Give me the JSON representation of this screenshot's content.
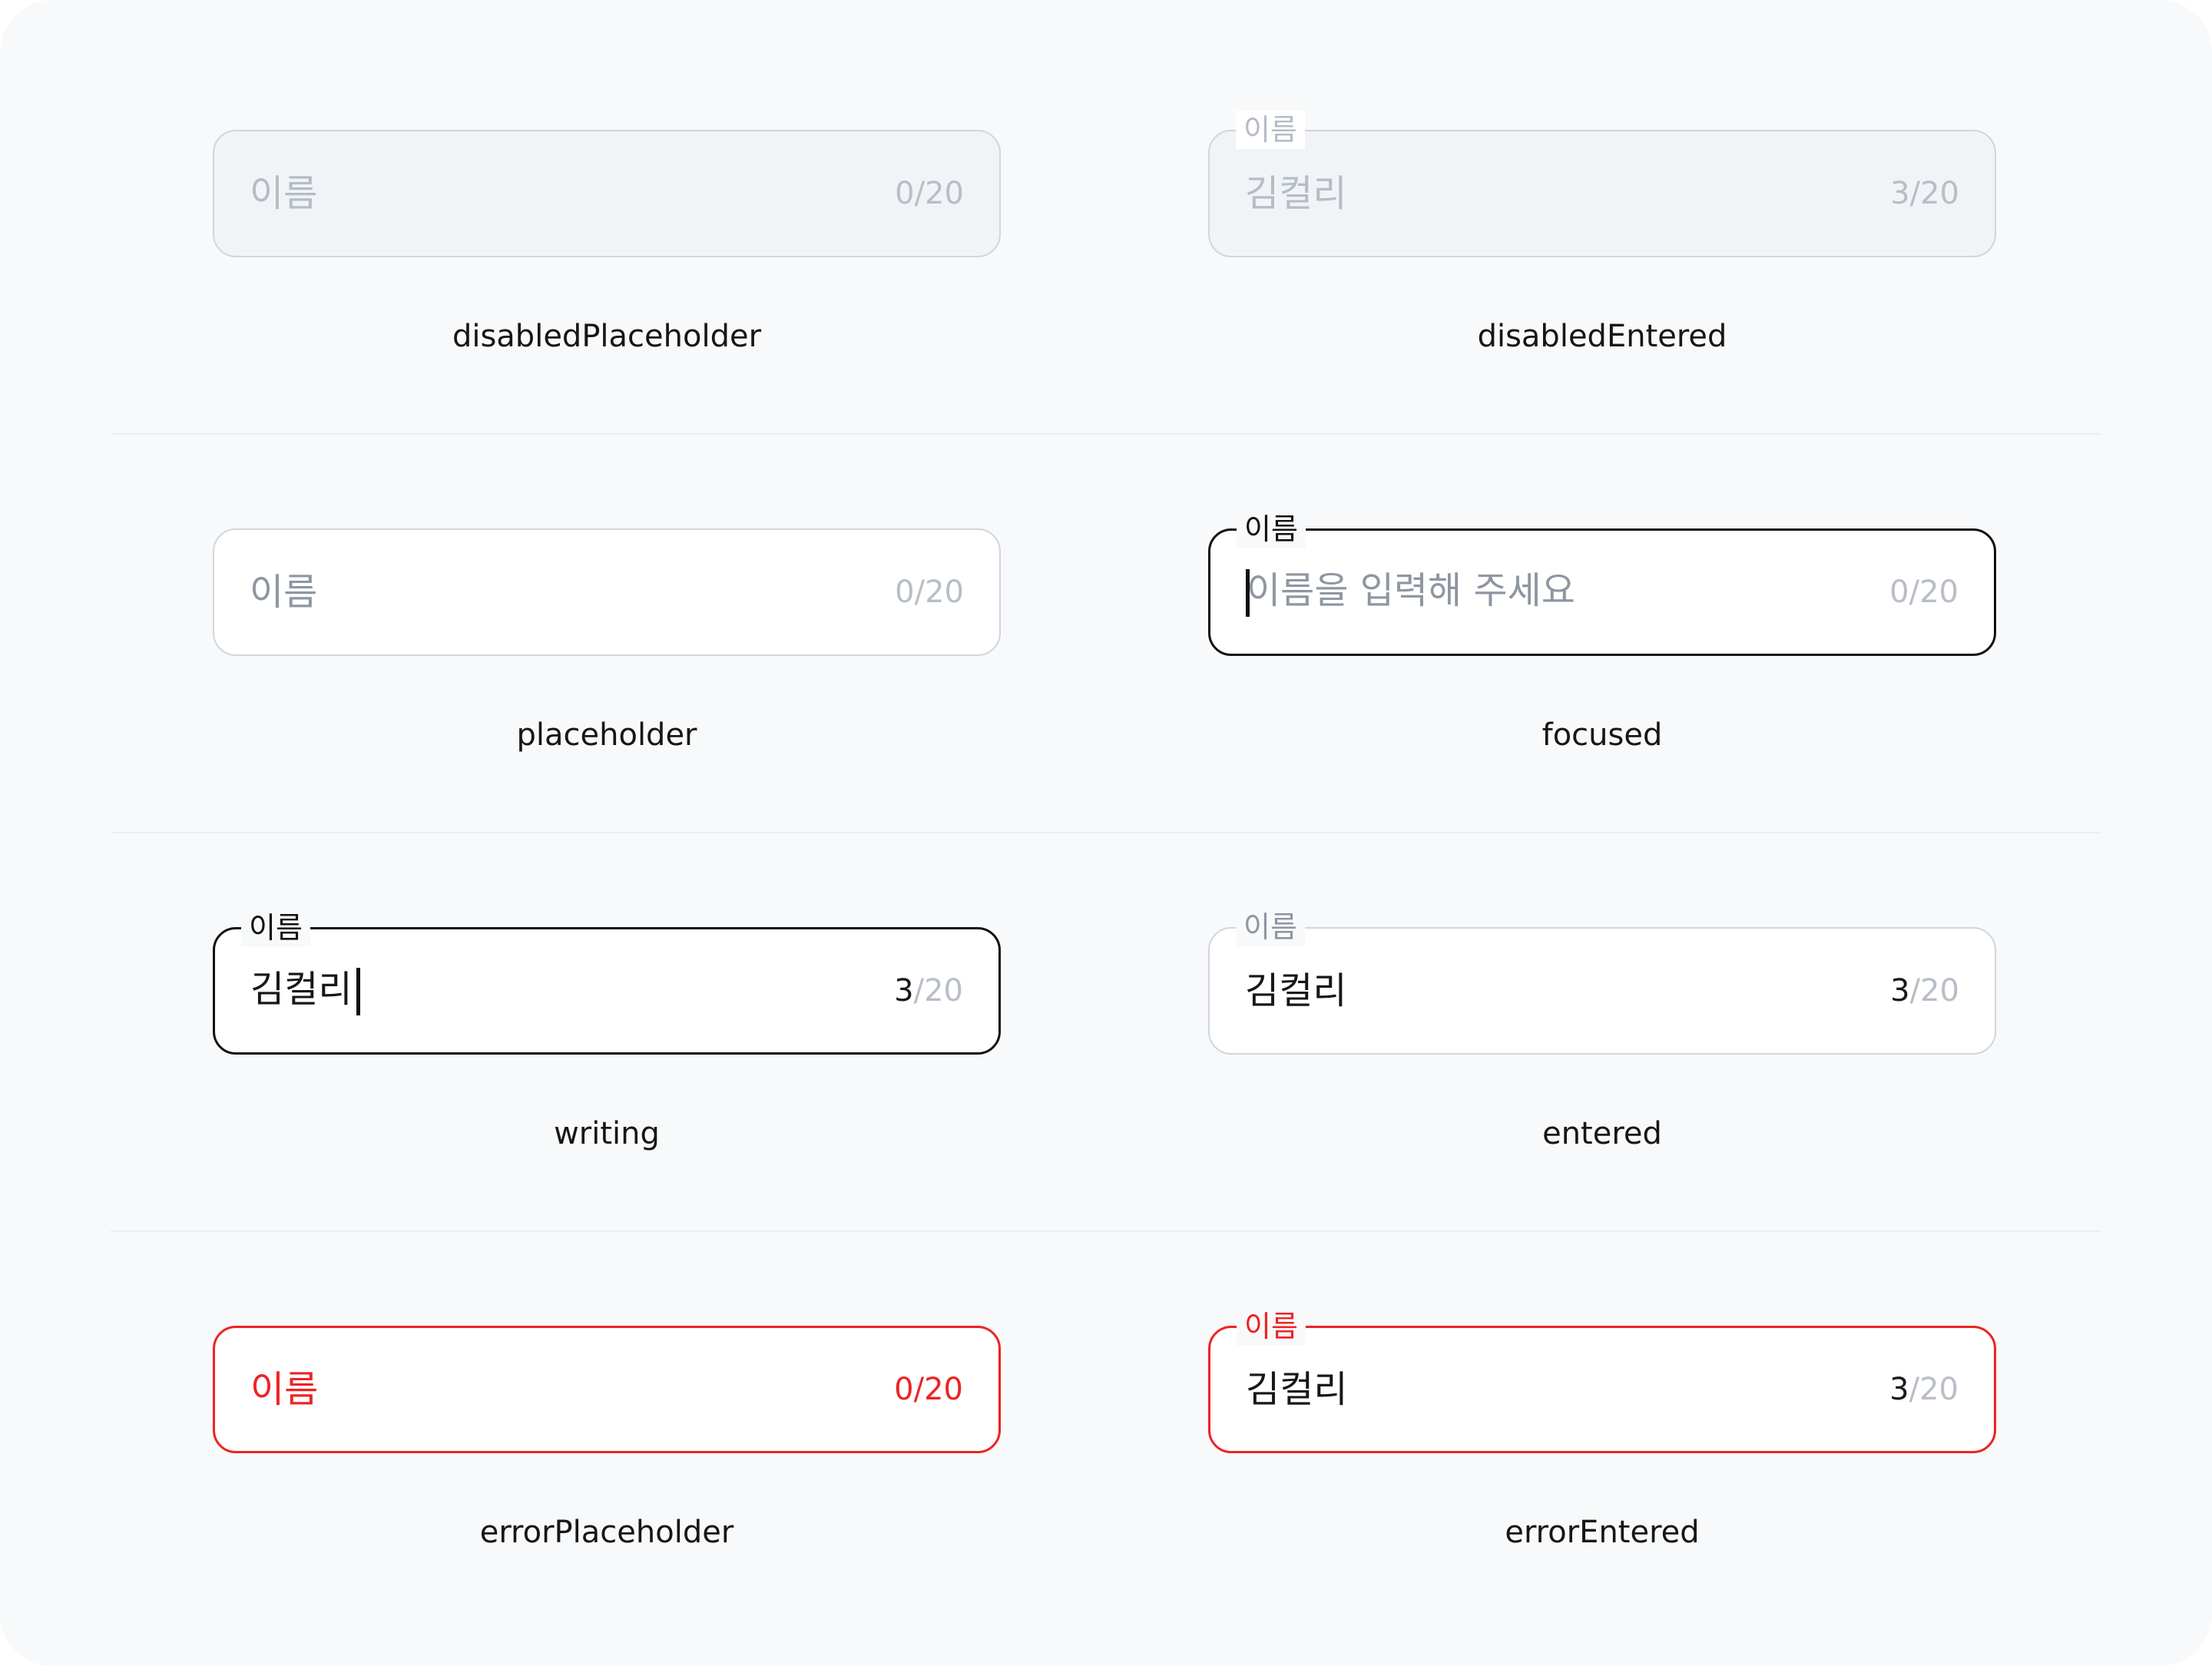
{
  "field_label": "이름",
  "states": {
    "disabledPlaceholder": {
      "caption": "disabledPlaceholder",
      "text": "이름",
      "count": "0",
      "max": "/20"
    },
    "disabledEntered": {
      "caption": "disabledEntered",
      "label": "이름",
      "text": "김컬리",
      "count": "3",
      "max": "/20"
    },
    "placeholder": {
      "caption": "placeholder",
      "text": "이름",
      "count": "0",
      "max": "/20"
    },
    "focused": {
      "caption": "focused",
      "label": "이름",
      "text": "이름을 입력해 주세요",
      "count": "0",
      "max": "/20"
    },
    "writing": {
      "caption": "writing",
      "label": "이름",
      "text": "김컬리",
      "count": "3",
      "max": "/20"
    },
    "entered": {
      "caption": "entered",
      "label": "이름",
      "text": "김컬리",
      "count": "3",
      "max": "/20"
    },
    "errorPlaceholder": {
      "caption": "errorPlaceholder",
      "text": "이름",
      "count": "0",
      "max": "/20"
    },
    "errorEntered": {
      "caption": "errorEntered",
      "label": "이름",
      "text": "김컬리",
      "count": "3",
      "max": "/20"
    }
  },
  "colors": {
    "background": "#f8f9fa",
    "border_default": "#cfd6df",
    "border_active": "#121212",
    "error": "#ec2424",
    "disabled_fill": "#f1f4f6",
    "muted_text": "#b8bec8"
  }
}
